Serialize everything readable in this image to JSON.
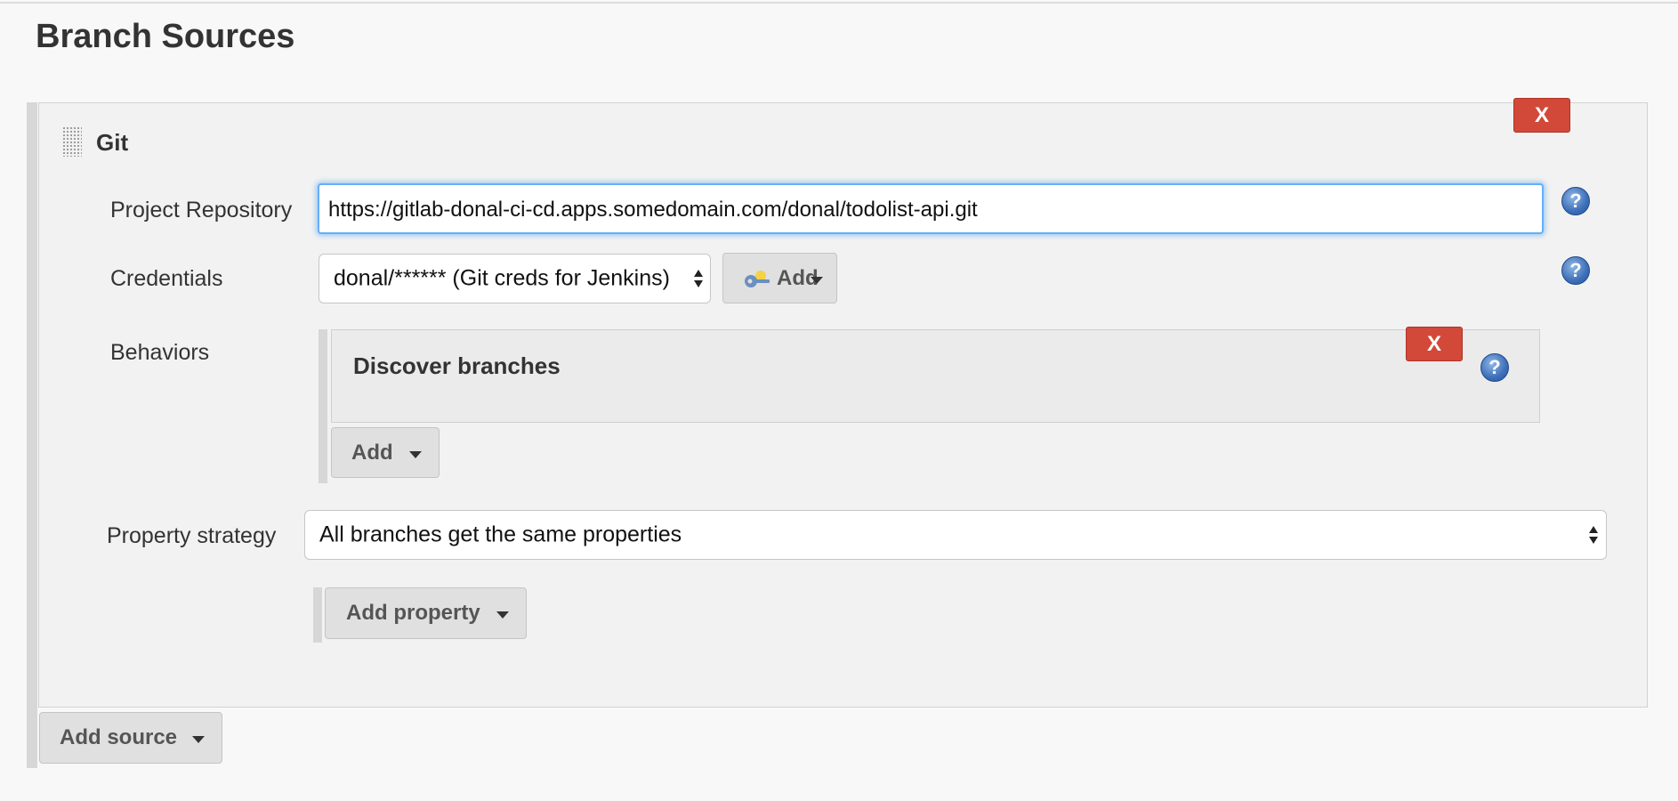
{
  "page": {
    "title": "Branch Sources"
  },
  "git_source": {
    "title": "Git",
    "delete_label": "X",
    "repository": {
      "label": "Project Repository",
      "value": "https://gitlab-donal-ci-cd.apps.somedomain.com/donal/todolist-api.git"
    },
    "credentials": {
      "label": "Credentials",
      "selected": "donal/****** (Git creds for Jenkins)",
      "add_label": "Add"
    },
    "behaviors": {
      "label": "Behaviors",
      "items": [
        {
          "title": "Discover branches",
          "delete_label": "X"
        }
      ],
      "add_label": "Add"
    },
    "property_strategy": {
      "label": "Property strategy",
      "selected": "All branches get the same properties",
      "add_property_label": "Add property"
    },
    "help_symbol": "?"
  },
  "add_source_label": "Add source",
  "colors": {
    "delete": "#d24939",
    "focus": "#66aff5",
    "help": "#3d6fb8"
  },
  "icons": [
    "drag-handle-icon",
    "key-icon",
    "help-icon",
    "caret-down-icon",
    "select-arrows-icon"
  ]
}
